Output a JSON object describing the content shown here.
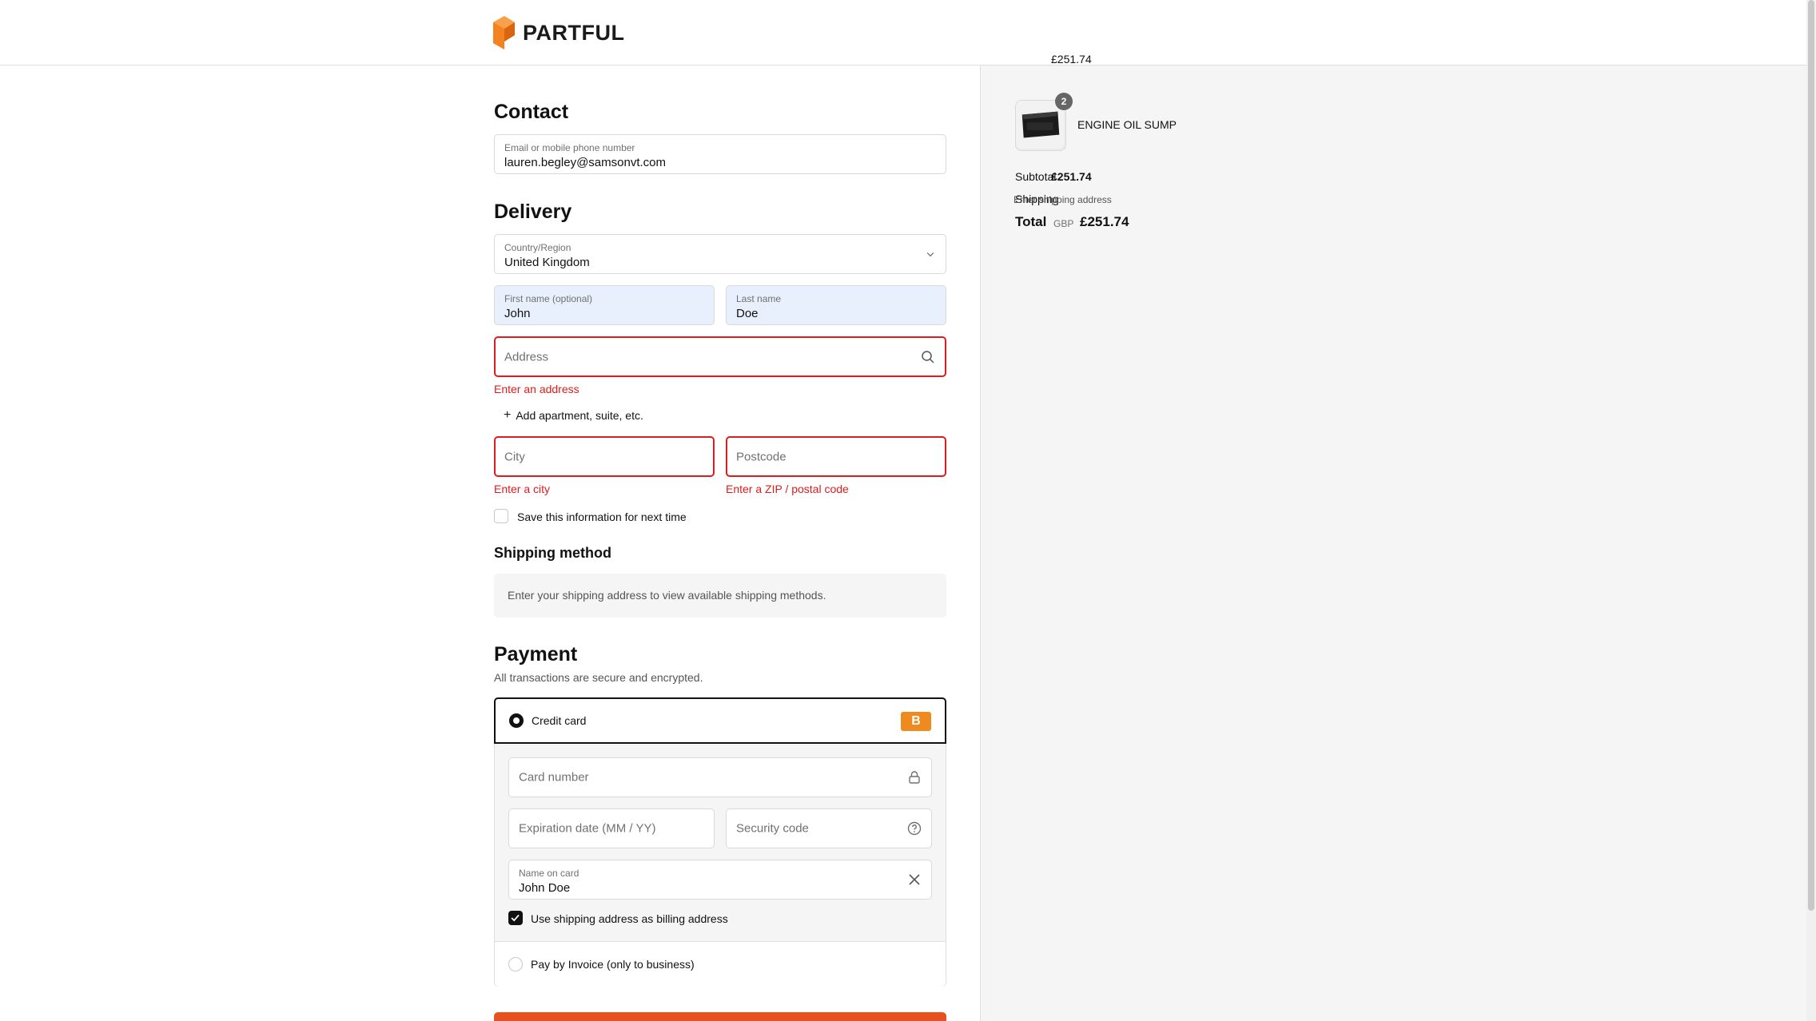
{
  "brand": {
    "name": "PARTFUL",
    "color": "#f58220"
  },
  "contact": {
    "heading": "Contact",
    "email_label": "Email or mobile phone number",
    "email_value": "lauren.begley@samsonvt.com"
  },
  "delivery": {
    "heading": "Delivery",
    "country_label": "Country/Region",
    "country_value": "United Kingdom",
    "first_name_label": "First name (optional)",
    "first_name_value": "John",
    "last_name_label": "Last name",
    "last_name_value": "Doe",
    "address_placeholder": "Address",
    "address_error": "Enter an address",
    "add_apartment": "Add apartment, suite, etc.",
    "city_placeholder": "City",
    "city_error": "Enter a city",
    "postcode_placeholder": "Postcode",
    "postcode_error": "Enter a ZIP / postal code",
    "save_info_label": "Save this information for next time"
  },
  "shipping_method": {
    "heading": "Shipping method",
    "notice": "Enter your shipping address to view available shipping methods."
  },
  "payment": {
    "heading": "Payment",
    "subtitle": "All transactions are secure and encrypted.",
    "credit_card_label": "Credit card",
    "card_badge": "B",
    "card_number_placeholder": "Card number",
    "expiration_placeholder": "Expiration date (MM / YY)",
    "security_placeholder": "Security code",
    "name_label": "Name on card",
    "name_value": "John Doe",
    "billing_same_label": "Use shipping address as billing address",
    "invoice_label": "Pay by Invoice (only to business)"
  },
  "summary": {
    "item_name": "ENGINE OIL SUMP",
    "item_qty": "2",
    "item_price": "£251.74",
    "subtotal_label": "Subtotal",
    "subtotal_value": "£251.74",
    "shipping_label": "Shipping",
    "shipping_value": "Enter shipping address",
    "total_label": "Total",
    "currency": "GBP",
    "total_value": "£251.74"
  },
  "colors": {
    "error": "#dd1d1d",
    "accent": "#e8501e",
    "autofill": "#e8f0fe"
  }
}
